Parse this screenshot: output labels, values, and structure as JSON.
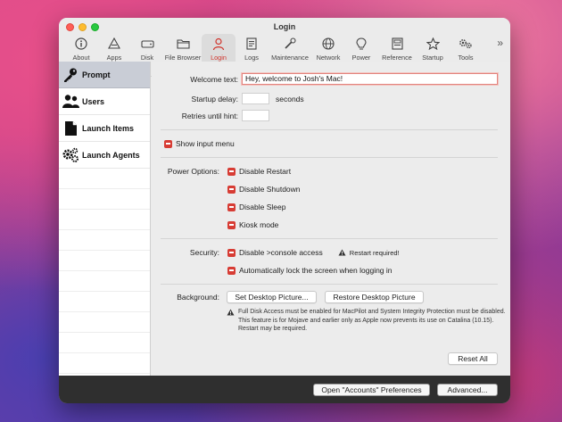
{
  "window": {
    "title": "Login"
  },
  "toolbar": {
    "items": [
      {
        "label": "About",
        "icon": "info-icon"
      },
      {
        "label": "Apps",
        "icon": "apps-icon"
      },
      {
        "label": "Disk",
        "icon": "disk-icon"
      },
      {
        "label": "File Browser",
        "icon": "folder-icon"
      },
      {
        "label": "Login",
        "icon": "login-icon"
      },
      {
        "label": "Logs",
        "icon": "logs-icon"
      },
      {
        "label": "Maintenance",
        "icon": "maintenance-icon"
      },
      {
        "label": "Network",
        "icon": "globe-icon"
      },
      {
        "label": "Power",
        "icon": "bulb-icon"
      },
      {
        "label": "Reference",
        "icon": "book-icon"
      },
      {
        "label": "Startup",
        "icon": "star-icon"
      },
      {
        "label": "Tools",
        "icon": "gears-icon"
      }
    ],
    "overflow": "»",
    "active": "Login"
  },
  "sidebar": {
    "items": [
      {
        "label": "Prompt",
        "icon": "key-icon",
        "active": true
      },
      {
        "label": "Users",
        "icon": "users-icon"
      },
      {
        "label": "Launch Items",
        "icon": "document-icon"
      },
      {
        "label": "Launch Agents",
        "icon": "gears-icon"
      }
    ]
  },
  "prompt": {
    "welcome_label": "Welcome text:",
    "welcome_value": "Hey, welcome to Josh's Mac!",
    "startup_delay_label": "Startup delay:",
    "startup_delay_value": "",
    "startup_delay_unit": "seconds",
    "retries_label": "Retries until hint:",
    "retries_value": "",
    "show_input_menu": "Show input menu"
  },
  "power": {
    "label": "Power Options:",
    "options": [
      "Disable Restart",
      "Disable Shutdown",
      "Disable Sleep",
      "Kiosk mode"
    ]
  },
  "security": {
    "label": "Security:",
    "disable_console": "Disable >console access",
    "restart_required": "Restart required!",
    "auto_lock": "Automatically lock the screen when logging in"
  },
  "background": {
    "label": "Background:",
    "set_button": "Set Desktop Picture...",
    "restore_button": "Restore Desktop Picture",
    "note": "Full Disk Access must be enabled for MacPilot and System Integrity Protection must be disabled. This feature is for Mojave and earlier only as Apple now prevents its use on Catalina (10.15). Restart may be required."
  },
  "buttons": {
    "reset_all": "Reset All",
    "accounts_prefs": "Open \"Accounts\" Preferences",
    "advanced": "Advanced..."
  },
  "colors": {
    "accent": "#d73c34"
  }
}
